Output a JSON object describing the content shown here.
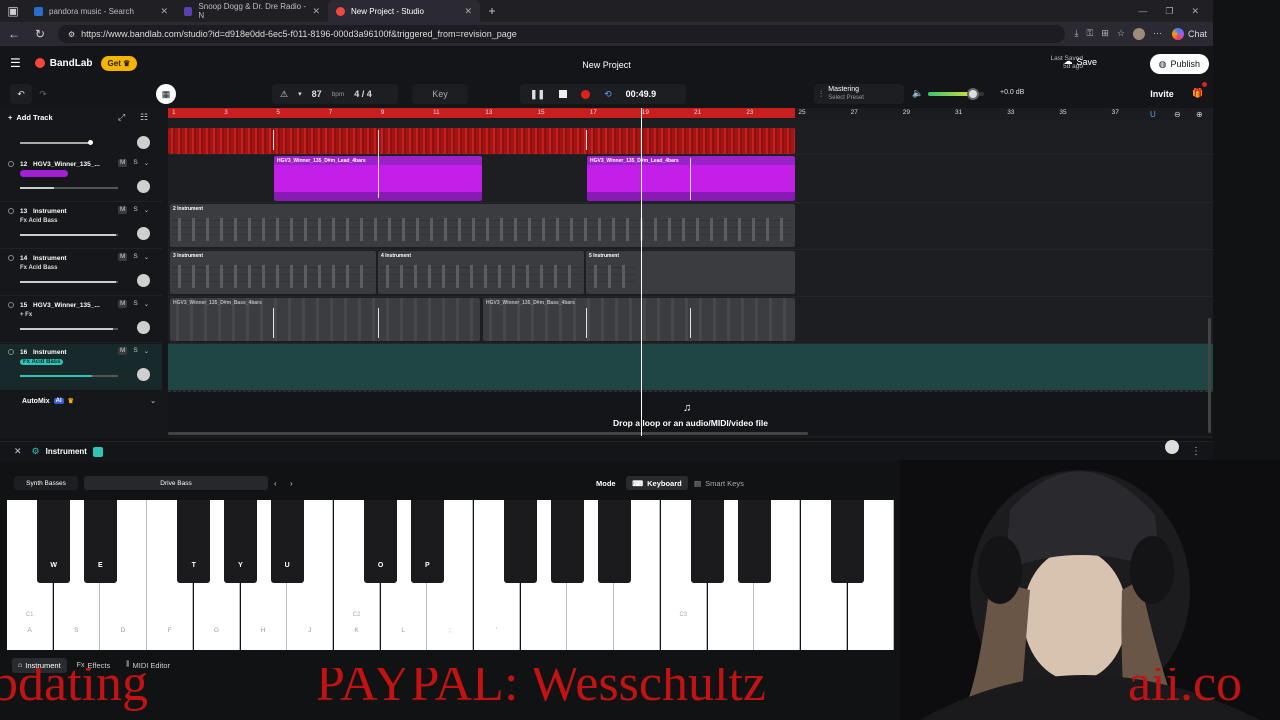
{
  "browser": {
    "tabs": [
      {
        "label": "pandora music - Search"
      },
      {
        "label": "Snoop Dogg & Dr. Dre Radio - N"
      },
      {
        "label": "New Project - Studio",
        "active": true
      }
    ],
    "url": "https://www.bandlab.com/studio?id=d918e0dd-6ec5-f011-8196-000d3a96100f&triggered_from=revision_page",
    "chat_label": "Chat"
  },
  "app": {
    "logo": "BandLab",
    "get_label": "Get",
    "title": "New Project",
    "last_saved_label": "Last Saved",
    "last_saved_value": "5d ago",
    "save_label": "Save",
    "publish_label": "Publish",
    "invite_label": "Invite"
  },
  "toolbar": {
    "bpm_value": "87",
    "bpm_unit": "bpm",
    "time_signature": "4 / 4",
    "key_label": "Key",
    "time_display": "00:49.9",
    "mastering_label": "Mastering",
    "mastering_sub": "Select Preset",
    "volume_db": "+0.0 dB",
    "volume_level": 0.8
  },
  "tracks_panel": {
    "add_track_label": "Add Track",
    "automix_label": "AutoMix",
    "automix_badge": "AI"
  },
  "tracks": [
    {
      "num": "12",
      "name": "HGV3_Winner_135_...",
      "sub": "",
      "m": "M",
      "s": "S",
      "volume": 0.35
    },
    {
      "num": "13",
      "name": "Instrument",
      "sub": "Fx Acid Bass",
      "m": "M",
      "s": "S",
      "volume": 0.98
    },
    {
      "num": "14",
      "name": "Instrument",
      "sub": "Fx Acid Bass",
      "m": "M",
      "s": "S",
      "volume": 0.98
    },
    {
      "num": "15",
      "name": "HGV3_Winner_135_...",
      "sub": "+ Fx",
      "m": "M",
      "s": "S",
      "volume": 0.95
    },
    {
      "num": "16",
      "name": "Instrument",
      "sub": "Fx Acid Bass",
      "m": "M",
      "s": "S",
      "volume": 0.73
    }
  ],
  "ruler_ticks": [
    "1",
    "3",
    "5",
    "7",
    "9",
    "11",
    "13",
    "15",
    "17",
    "19",
    "21",
    "23",
    "25",
    "27",
    "29",
    "31",
    "33",
    "35",
    "37"
  ],
  "clips": {
    "lead": "HGV3_Winner_135_D#m_Lead_4bars",
    "bass": "HGV3_Winner_135_D#m_Bass_4bars",
    "instrument": "Instrument",
    "midi_numbers": [
      "2",
      "3",
      "4",
      "5"
    ]
  },
  "dropzone_text": "Drop a loop or an audio/MIDI/video file",
  "instrument_panel": {
    "title": "Instrument",
    "preset_category": "Synth Basses",
    "preset_name": "Drive Bass",
    "mode_label": "Mode",
    "keyboard_label": "Keyboard",
    "smart_keys_label": "Smart Keys"
  },
  "piano": {
    "white_keys": [
      {
        "key": "A",
        "note": "C1"
      },
      {
        "key": "S",
        "note": ""
      },
      {
        "key": "D",
        "note": ""
      },
      {
        "key": "F",
        "note": ""
      },
      {
        "key": "G",
        "note": ""
      },
      {
        "key": "H",
        "note": ""
      },
      {
        "key": "J",
        "note": ""
      },
      {
        "key": "K",
        "note": "C2"
      },
      {
        "key": "L",
        "note": ""
      },
      {
        "key": ";",
        "note": ""
      },
      {
        "key": "'",
        "note": ""
      },
      {
        "key": "",
        "note": ""
      },
      {
        "key": "",
        "note": ""
      },
      {
        "key": "",
        "note": ""
      },
      {
        "key": "",
        "note": "C3"
      },
      {
        "key": "",
        "note": ""
      },
      {
        "key": "",
        "note": ""
      },
      {
        "key": "",
        "note": ""
      },
      {
        "key": "",
        "note": ""
      }
    ],
    "black_keys": [
      "W",
      "E",
      "T",
      "Y",
      "U",
      "O",
      "P",
      "",
      "",
      "",
      "",
      "",
      ""
    ]
  },
  "bottom_tabs": [
    {
      "label": "Instrument",
      "active": true
    },
    {
      "label": "Effects"
    },
    {
      "label": "MIDI Editor"
    }
  ],
  "overlay_text": {
    "left": "bdating",
    "right": "PAYPAL: Wesschultz",
    "far_right": "aii.co"
  },
  "colors": {
    "accent_red": "#c81e1e",
    "clip_purple": "#c41fe8",
    "track_teal": "#1f4b4b",
    "badge_teal": "#2ec4b6",
    "get_yellow": "#f5b400"
  }
}
